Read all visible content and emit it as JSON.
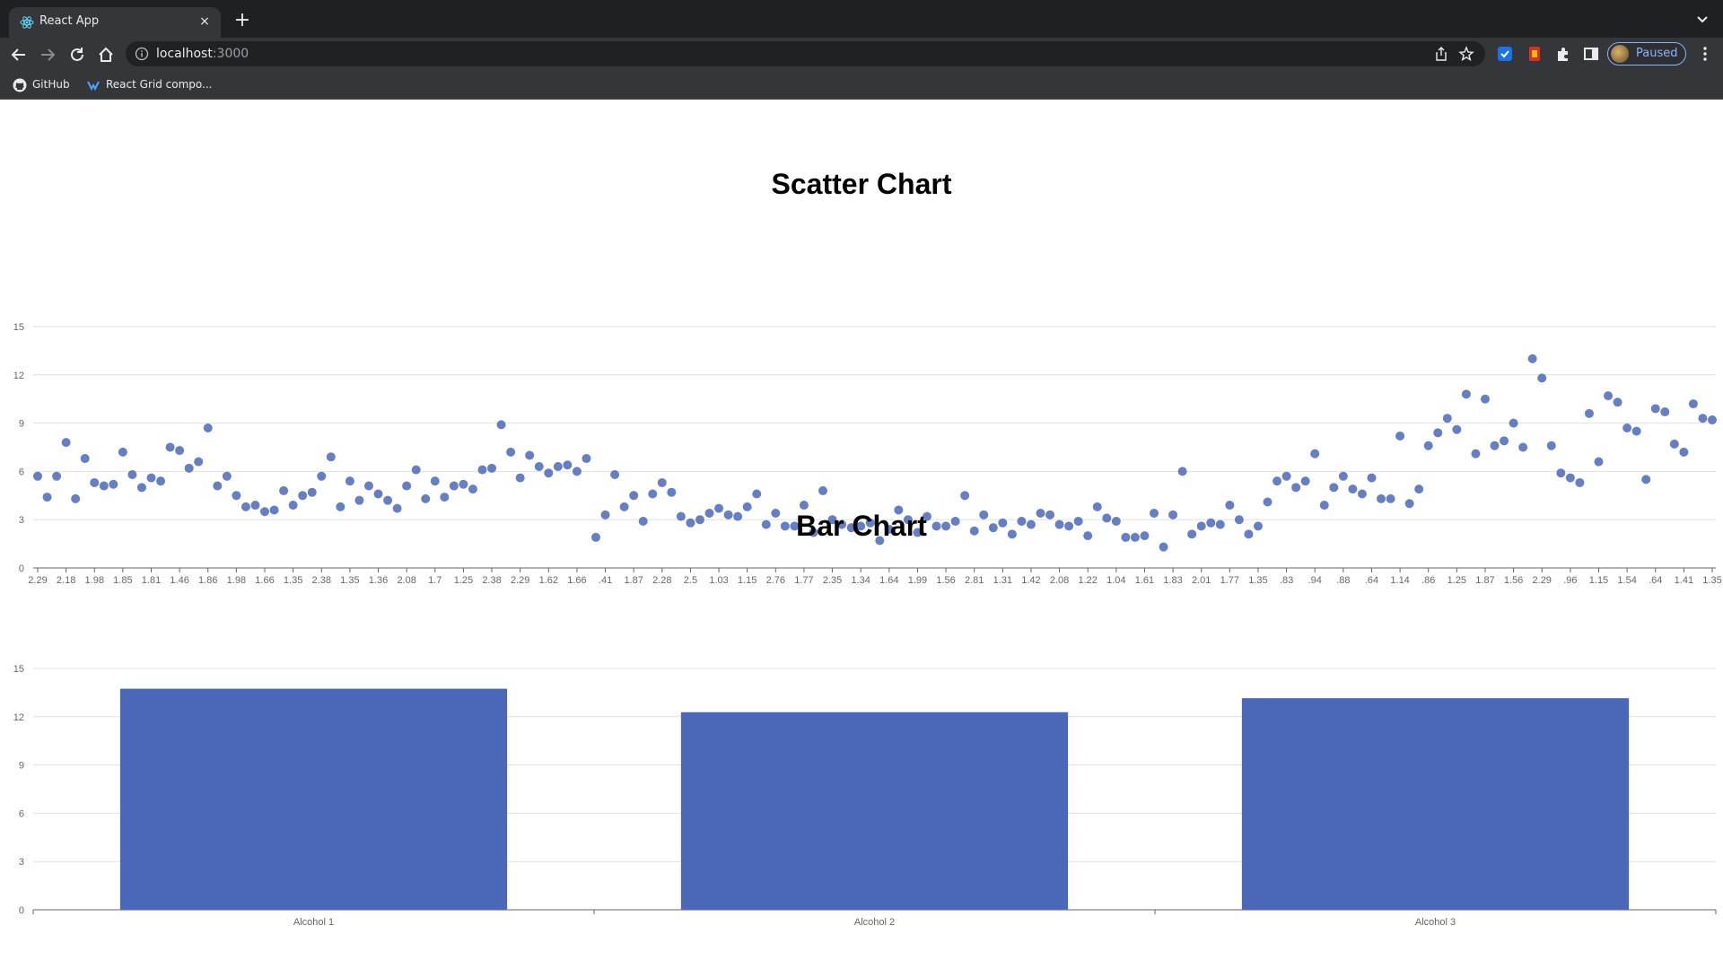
{
  "browser": {
    "tab_title": "React App",
    "tab_close": "×",
    "new_tab": "+",
    "url_host": "localhost",
    "url_port": ":3000",
    "profile_label": "Paused",
    "bookmarks": [
      {
        "label": "GitHub",
        "icon": "github-icon"
      },
      {
        "label": "React Grid compo...",
        "icon": "react-grid-icon"
      }
    ]
  },
  "colors": {
    "series": "#4b67b8",
    "grid": "#e0e0e0",
    "axis": "#666666"
  },
  "chart_data": [
    {
      "type": "scatter",
      "title": "Scatter Chart",
      "xlabel": "",
      "ylabel": "",
      "ylim": [
        0,
        15
      ],
      "y_ticks": [
        0,
        3,
        6,
        9,
        12,
        15
      ],
      "grid": true,
      "x": [
        "2.29",
        "2.18",
        "1.98",
        "1.85",
        "1.81",
        "1.46",
        "1.86",
        "1.98",
        "1.66",
        "1.35",
        "2.38",
        "1.35",
        "1.36",
        "2.08",
        "1.7",
        "1.25",
        "2.38",
        "2.29",
        "1.62",
        "1.66",
        ".41",
        "1.87",
        "2.28",
        "2.5",
        "1.03",
        "1.15",
        "2.76",
        "1.77",
        "2.35",
        "1.34",
        "1.64",
        "1.99",
        "1.56",
        "2.81",
        "1.31",
        "1.42",
        "2.08",
        "1.22",
        "1.04",
        "1.61",
        "1.83",
        "2.01",
        "1.77",
        "1.35",
        ".83",
        ".94",
        ".88",
        ".64",
        "1.14",
        ".86",
        "1.25",
        "1.87",
        "1.56",
        "2.29",
        ".96",
        "1.15",
        "1.54",
        ".64",
        "1.41",
        "1.35"
      ],
      "y": [
        5.7,
        4.4,
        5.7,
        7.8,
        4.3,
        6.8,
        5.3,
        5.1,
        5.2,
        7.2,
        5.8,
        5.0,
        5.6,
        5.4,
        7.5,
        7.3,
        6.2,
        6.6,
        8.7,
        5.1,
        5.7,
        4.5,
        3.8,
        3.9,
        3.5,
        3.6,
        4.8,
        3.9,
        4.5,
        4.7,
        5.7,
        6.9,
        3.8,
        5.4,
        4.2,
        5.1,
        4.6,
        4.2,
        3.7,
        5.1,
        6.1,
        4.3,
        5.4,
        4.4,
        5.1,
        5.2,
        4.9,
        6.1,
        6.2,
        8.9,
        7.2,
        5.6,
        7.0,
        6.3,
        5.9,
        6.3,
        6.4,
        6.0,
        6.8,
        1.9,
        3.3,
        5.8,
        3.8,
        4.5,
        2.9,
        4.6,
        5.3,
        4.7,
        3.2,
        2.8,
        3.0,
        3.4,
        3.7,
        3.3,
        3.2,
        3.8,
        4.6,
        2.7,
        3.4,
        2.6,
        2.6,
        3.9,
        2.2,
        4.8,
        3.0,
        2.7,
        2.5,
        2.6,
        2.8,
        1.7,
        2.4,
        3.6,
        3.0,
        2.2,
        3.2,
        2.6,
        2.6,
        2.9,
        4.5,
        2.3,
        3.3,
        2.5,
        2.8,
        2.1,
        2.9,
        2.7,
        3.4,
        3.3,
        2.7,
        2.6,
        2.9,
        2.0,
        3.8,
        3.1,
        2.9,
        1.9,
        1.9,
        2.0,
        3.4,
        1.3,
        3.3,
        6.0,
        2.1,
        2.6,
        2.8,
        2.7,
        3.9,
        3.0,
        2.1,
        2.6,
        4.1,
        5.4,
        5.7,
        5.0,
        5.4,
        7.1,
        3.9,
        5.0,
        5.7,
        4.9,
        4.6,
        5.6,
        4.3,
        4.3,
        8.2,
        4.0,
        4.9,
        7.6,
        8.4,
        9.3,
        8.6,
        10.8,
        7.1,
        10.5,
        7.6,
        7.9,
        9.0,
        7.5,
        13.0,
        11.8,
        7.6,
        5.9,
        5.6,
        5.3,
        9.6,
        6.6,
        10.7,
        10.3,
        8.7,
        8.5,
        5.5,
        9.9,
        9.7,
        7.7,
        7.2,
        10.2,
        9.3,
        9.2
      ]
    },
    {
      "type": "bar",
      "title": "Bar Chart",
      "xlabel": "",
      "ylabel": "",
      "ylim": [
        0,
        15
      ],
      "y_ticks": [
        0,
        3,
        6,
        9,
        12,
        15
      ],
      "grid": true,
      "categories": [
        "Alcohol 1",
        "Alcohol 2",
        "Alcohol 3"
      ],
      "values": [
        13.74,
        12.28,
        13.15
      ]
    }
  ]
}
